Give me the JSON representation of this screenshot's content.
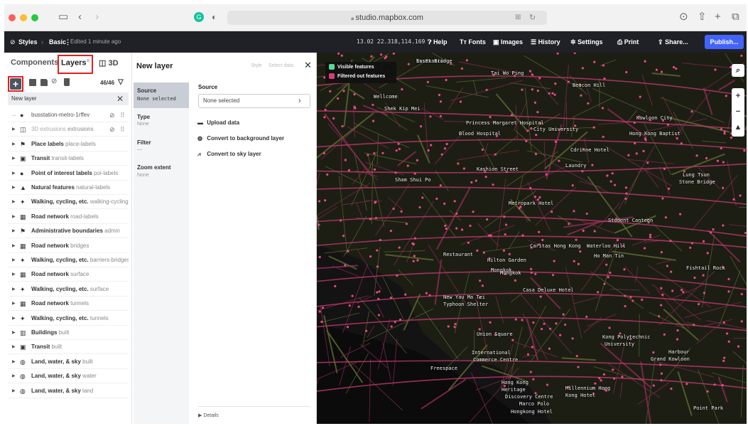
{
  "browser": {
    "url": "studio.mapbox.com",
    "window_buttons": [
      "close",
      "minimize",
      "maximize"
    ]
  },
  "toolbar": {
    "styles": "Styles",
    "style_name": "Basic",
    "edited": "Edited 1 minute ago",
    "zoom_coords": "13.02 22.318,114.169",
    "help": "Help",
    "fonts": "Fonts",
    "images": "Images",
    "history": "History",
    "settings": "Settings",
    "print": "Print",
    "share": "Share...",
    "publish": "Publish..."
  },
  "left_panel": {
    "tabs": {
      "components": "Components",
      "layers": "Layers",
      "three_d": "3D"
    },
    "layer_count": "46/46",
    "search_value": "New layer",
    "layers": [
      {
        "icon": "bus-icon",
        "glyph": "●",
        "title": "busstation-metro-1rffev",
        "sub": "",
        "expand": "…"
      },
      {
        "icon": "cube-icon",
        "glyph": "◫",
        "title": "3D extrusions",
        "sub": "extrusions",
        "expand": "▶",
        "muted": true
      },
      {
        "icon": "place-icon",
        "glyph": "⚑",
        "title": "Place labels",
        "sub": "place-labels",
        "expand": "▶"
      },
      {
        "icon": "transit-icon",
        "glyph": "▣",
        "title": "Transit",
        "sub": "transit-labels",
        "expand": "▶"
      },
      {
        "icon": "pin-icon",
        "glyph": "●",
        "title": "Point of interest labels",
        "sub": "poi-labels",
        "expand": "▶"
      },
      {
        "icon": "nature-icon",
        "glyph": "▲",
        "title": "Natural features",
        "sub": "natural-labels",
        "expand": "▶"
      },
      {
        "icon": "walk-icon",
        "glyph": "✦",
        "title": "Walking, cycling, etc.",
        "sub": "walking-cycling-l",
        "expand": "▶"
      },
      {
        "icon": "road-icon",
        "glyph": "▦",
        "title": "Road network",
        "sub": "road-labels",
        "expand": "▶"
      },
      {
        "icon": "flag-icon",
        "glyph": "⚑",
        "title": "Administrative boundaries",
        "sub": "admin",
        "expand": "▶"
      },
      {
        "icon": "road-icon",
        "glyph": "▦",
        "title": "Road network",
        "sub": "bridges",
        "expand": "▶"
      },
      {
        "icon": "walk-icon",
        "glyph": "✦",
        "title": "Walking, cycling, etc.",
        "sub": "barriers-bridges",
        "expand": "▶"
      },
      {
        "icon": "road-icon",
        "glyph": "▦",
        "title": "Road network",
        "sub": "surface",
        "expand": "▶"
      },
      {
        "icon": "walk-icon",
        "glyph": "✦",
        "title": "Walking, cycling, etc.",
        "sub": "surface",
        "expand": "▶"
      },
      {
        "icon": "road-icon",
        "glyph": "▦",
        "title": "Road network",
        "sub": "tunnels",
        "expand": "▶"
      },
      {
        "icon": "walk-icon",
        "glyph": "✦",
        "title": "Walking, cycling, etc.",
        "sub": "tunnels",
        "expand": "▶"
      },
      {
        "icon": "building-icon",
        "glyph": "▥",
        "title": "Buildings",
        "sub": "built",
        "expand": "▶"
      },
      {
        "icon": "transit-icon",
        "glyph": "▣",
        "title": "Transit",
        "sub": "built",
        "expand": "▶"
      },
      {
        "icon": "globe-icon",
        "glyph": "◍",
        "title": "Land, water, & sky",
        "sub": "built",
        "expand": "▶"
      },
      {
        "icon": "globe-icon",
        "glyph": "◍",
        "title": "Land, water, & sky",
        "sub": "water",
        "expand": "▶"
      },
      {
        "icon": "globe-icon",
        "glyph": "◍",
        "title": "Land, water, & sky",
        "sub": "land",
        "expand": "▶"
      }
    ]
  },
  "mid_panel": {
    "title": "New layer",
    "style": "Style",
    "select_data": "Select data",
    "nav": {
      "source": "Source",
      "source_value": "None selected",
      "type": "Type",
      "type_value": "None",
      "filter": "Filter",
      "filter_value": "—",
      "zoom": "Zoom extent",
      "zoom_value": "None"
    },
    "source_heading": "Source",
    "source_select": "None selected",
    "upload": "Upload data",
    "background": "Convert to background layer",
    "sky": "Convert to sky layer",
    "details": "Details"
  },
  "map": {
    "legend": [
      {
        "label": "Visible features",
        "color": "#5fe0a0"
      },
      {
        "label": "Filtered out features",
        "color": "#e0407a"
      }
    ],
    "labels": [
      "busStation",
      "Tai Wo Ping",
      "Beacon Hill",
      "Shek Kip Mei",
      "Wellcome",
      "Kowloon City",
      "Princess Margaret Hospital",
      "Blood Hospital",
      "City University",
      "Hong Kong Baptist",
      "Metropark Hotel",
      "Student Canteen",
      "Caritas Hong Kong",
      "Waterloo Hill",
      "Ho Man Tin",
      "Mongkok",
      "Hilton Garden",
      "Fishtail Rock",
      "Casa Deluxe Hotel",
      "New Yau Ma Tei",
      "Typhoon Shelter",
      "Union Square",
      "International",
      "Commerce Centre",
      "Freespace",
      "Hong Kong",
      "Heritage",
      "Discovery Centre",
      "Millennium Hong",
      "Kong Hotel",
      "Harbour",
      "Grand Kowloon",
      "Marco Polo",
      "Hongkong Hotel",
      "Kong Polytechnic",
      "University",
      "Mongkok",
      "Restaurant",
      "Kashion Street",
      "Sham Shui Po",
      "Lung Tsun",
      "Stone Bridge",
      "Point Park",
      "Cdrinne Hotel",
      "Laundry",
      "Essex Bridge"
    ]
  }
}
